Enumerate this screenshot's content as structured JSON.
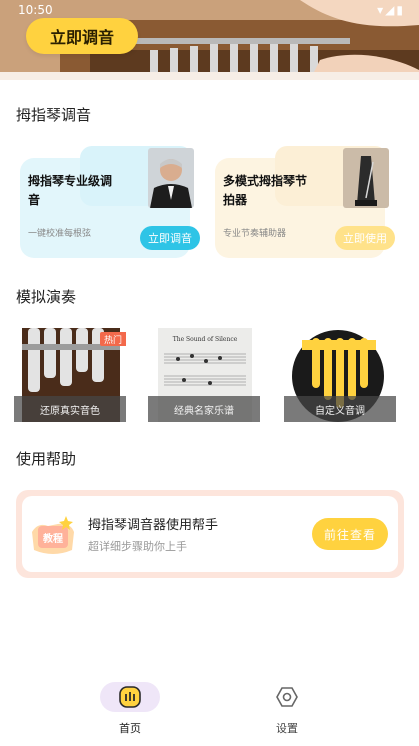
{
  "status_bar": {
    "time": "10:50",
    "icons": "▾◢▮"
  },
  "hero": {
    "button_label": "立即调音"
  },
  "sections": {
    "tuning": "拇指琴调音",
    "simulation": "模拟演奏",
    "help": "使用帮助"
  },
  "tuning_cards": [
    {
      "title": "拇指琴专业级调音",
      "desc": "一键校准每根弦",
      "button": "立即调音"
    },
    {
      "title": "多模式拇指琴节拍器",
      "desc": "专业节奏辅助器",
      "button": "立即使用"
    }
  ],
  "simulation_tiles": [
    {
      "caption": "还原真实音色",
      "badge": "热门"
    },
    {
      "caption": "经典名家乐谱",
      "sheet_title": "The Sound of Silence"
    },
    {
      "caption": "自定义音调"
    }
  ],
  "help_card": {
    "icon_text": "教程",
    "title": "拇指琴调音器使用帮手",
    "subtitle": "超详细步骤助你上手",
    "button": "前往查看"
  },
  "nav": [
    {
      "label": "首页",
      "active": true
    },
    {
      "label": "设置",
      "active": false
    }
  ],
  "colors": {
    "accent": "#ffd23f",
    "tune_pill": "#2ec4e6",
    "metronome_pill": "#ffd23f",
    "hot": "#f3694b"
  }
}
